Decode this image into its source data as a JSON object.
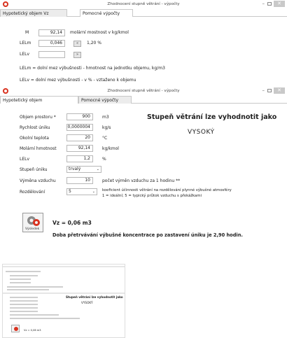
{
  "window1": {
    "title": "Zhodnocení stupně větrání - výpočty",
    "tabs": [
      "Hypotetický objem Vz",
      "Pomocné výpočty"
    ],
    "m_label": "M",
    "m_value": "92,14",
    "m_desc": "molární mostnost v kg/kmol",
    "lelm_label": "LELm",
    "lelm_value": "0,046",
    "lelm_btn": "«",
    "lelm_result": "1,20 %",
    "lelv_label": "LELv",
    "lelv_value": "",
    "lelv_btn": "»",
    "note1": "LELm = dolní mez výbušnosti - hmotnost na jednotku objemu, kg/m3",
    "note2": "LELv = dolní mez výbušnosti - v % - vztaženo k objemu"
  },
  "window2": {
    "title": "Zhodnocení stupně větrání - výpočty",
    "tabs": [
      "Hypotetický objem",
      "Pomocné výpočty"
    ],
    "fields": [
      {
        "label": "Objem prostoru *",
        "value": "900",
        "unit": "m3"
      },
      {
        "label": "Rychlost úniku",
        "value": "0,0000004",
        "unit": "kg/s"
      },
      {
        "label": "Okolní teplota",
        "value": "20",
        "unit": "°C"
      },
      {
        "label": "Molární hmotnost",
        "value": "92,14",
        "unit": "kg/kmol"
      },
      {
        "label": "LELv",
        "value": "1,2",
        "unit": "%"
      }
    ],
    "stupen_label": "Stupeň úniku",
    "stupen_value": "trvalý",
    "vymena_label": "Výměna vzduchu",
    "vymena_value": "10",
    "vymena_unit": "počet výměn vzduchu za 1 hodinu **",
    "rozdelovani_label": "Rozdělování",
    "rozdelovani_value": "5",
    "rozdelovani_note1": "koeficient účinnosti větrání na rozdělování plynné výbušné atmosféry",
    "rozdelovani_note2": "1 = ideální; 5 = typický průtok vzduchu s překážkami",
    "result_heading": "Stupeň větrání lze vyhodnotit jako",
    "result_value": "VYSOKÝ",
    "calc_button": "Výsledek",
    "vz_result": "Vz = 0,06 m3",
    "duration": "Doba přetrvávání výbušné koncentrace po zastavení úniku je 2,90 hodin."
  },
  "thumbnail": {
    "heading": "Stupeň větrání lze vyhodnotit jako",
    "value": "VYSOKÝ",
    "vz": "Vz = 0,06 m3"
  },
  "colors": {
    "accent_red": "#d9321f",
    "tab_inactive": "#ececec",
    "border": "#b8b8b8"
  }
}
